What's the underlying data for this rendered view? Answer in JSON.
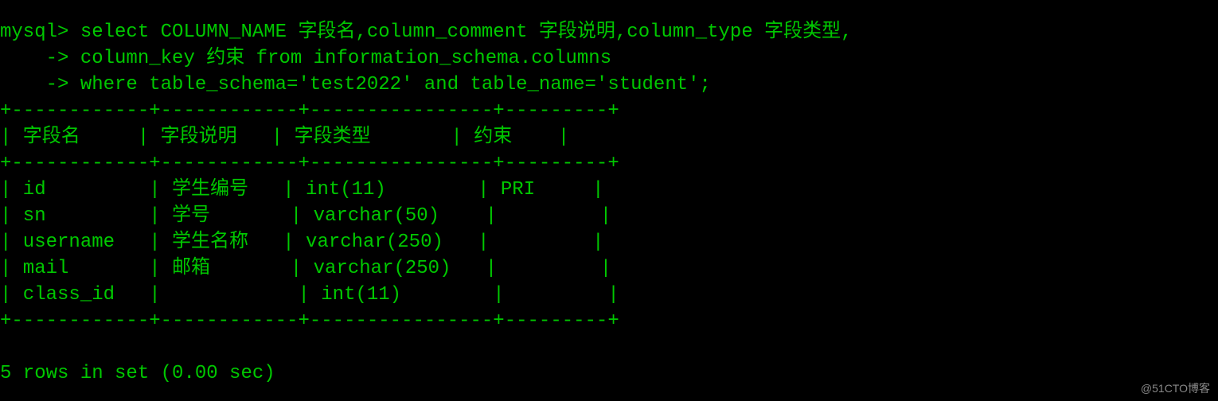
{
  "prompt": "mysql>",
  "cont": "    ->",
  "query": {
    "line1": " select COLUMN_NAME 字段名,column_comment 字段说明,column_type 字段类型,",
    "line2": " column_key 约束 from information_schema.columns",
    "line3": " where table_schema='test2022' and table_name='student';"
  },
  "border": "+----------+----------+--------------+-------+",
  "header": {
    "c1": "字段名",
    "c2": "字段说明",
    "c3": "字段类型",
    "c4": "约束"
  },
  "rows": [
    {
      "c1": "id",
      "c2": "学生编号",
      "c3": "int(11)",
      "c4": "PRI"
    },
    {
      "c1": "sn",
      "c2": "学号",
      "c3": "varchar(50)",
      "c4": ""
    },
    {
      "c1": "username",
      "c2": "学生名称",
      "c3": "varchar(250)",
      "c4": ""
    },
    {
      "c1": "mail",
      "c2": "邮箱",
      "c3": "varchar(250)",
      "c4": ""
    },
    {
      "c1": "class_id",
      "c2": "",
      "c3": "int(11)",
      "c4": ""
    }
  ],
  "footer": "5 rows in set (0.00 sec)",
  "watermark": "@51CTO博客"
}
